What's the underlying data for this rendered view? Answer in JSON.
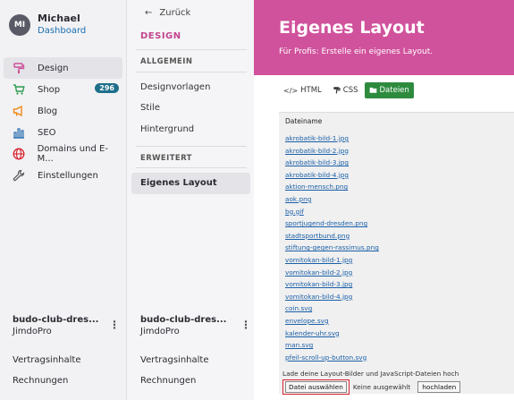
{
  "user": {
    "initials": "MI",
    "name": "Michael",
    "link": "Dashboard"
  },
  "nav": [
    {
      "label": "Design",
      "icon": "paint-roller-icon"
    },
    {
      "label": "Shop",
      "icon": "cart-icon",
      "badge": "296"
    },
    {
      "label": "Blog",
      "icon": "megaphone-icon"
    },
    {
      "label": "SEO",
      "icon": "bar-chart-icon"
    },
    {
      "label": "Domains und E-M...",
      "icon": "globe-icon"
    },
    {
      "label": "Einstellungen",
      "icon": "wrench-icon"
    }
  ],
  "site": {
    "name": "budo-club-dres...",
    "plan": "JimdoPro"
  },
  "bottom_links": {
    "contracts": "Vertragsinhalte",
    "invoices": "Rechnungen"
  },
  "mid": {
    "back": "Zurück",
    "title": "DESIGN",
    "section1": "ALLGEMEIN",
    "items1": [
      "Designvorlagen",
      "Stile",
      "Hintergrund"
    ],
    "section2": "ERWEITERT",
    "active": "Eigenes Layout"
  },
  "main": {
    "title": "Eigenes Layout",
    "subtitle": "Für Profis: Erstelle ein eigenes Layout.",
    "tabs": {
      "html": "HTML",
      "css": "CSS",
      "files": "Dateien"
    },
    "column_header": "Dateiname",
    "files": [
      "akrobatik-bild-1.jpg",
      "akrobatik-bild-2.jpg",
      "akrobatik-bild-3.jpg",
      "akrobatik-bild-4.jpg",
      "aktion-mensch.png",
      "aok.png",
      "bg.gif",
      "sportjugend-dresden.png",
      "stadtsportbund.png",
      "stiftung-gegen-rassimus.png",
      "vomitokan-bild-1.jpg",
      "vomitokan-bild-2.jpg",
      "vomitokan-bild-3.jpg",
      "vomitokan-bild-4.jpg",
      "coin.svg",
      "envelope.svg",
      "kalender-uhr.svg",
      "man.svg",
      "pfeil-scroll-up-button.svg"
    ],
    "upload_text": "Lade deine Layout-Bilder und JavaScript-Dateien hoch",
    "choose_label": "Datei auswählen",
    "no_file": "Keine ausgewählt",
    "upload_label": "hochladen"
  },
  "colors": {
    "accent": "#c2458e",
    "hero": "#d0529c",
    "badge": "#1f6f8b",
    "active_tab": "#2e8b3e"
  }
}
